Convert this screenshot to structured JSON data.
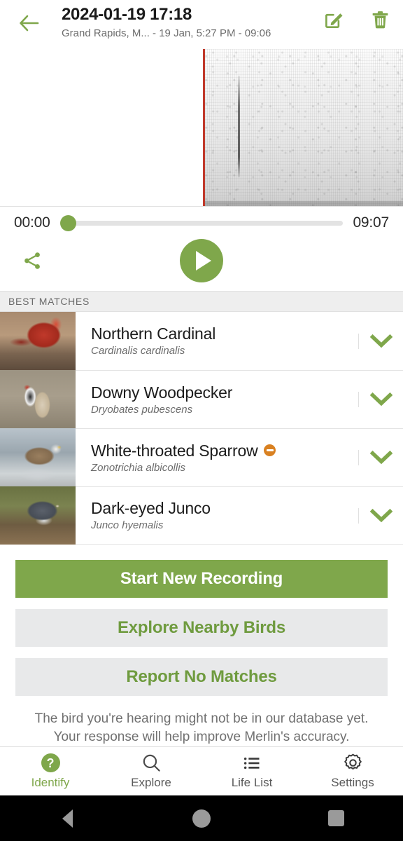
{
  "header": {
    "back_icon": "arrow-left-icon",
    "title": "2024-01-19 17:18",
    "subtitle": "Grand Rapids, M... - 19 Jan, 5:27 PM - 09:06",
    "edit_icon": "edit-pencil-icon",
    "delete_icon": "trash-icon"
  },
  "player": {
    "current_time": "00:00",
    "total_time": "09:07",
    "progress_percent": 0,
    "share_icon": "share-icon",
    "play_icon": "play-icon",
    "playhead_label": "recording-playhead"
  },
  "matches": {
    "section_label": "BEST MATCHES",
    "rows": [
      {
        "name": "Northern Cardinal",
        "scientific": "Cardinalis cardinalis",
        "thumb_class": "t-cardinal",
        "badge": false,
        "chevron_icon": "chevron-down-icon"
      },
      {
        "name": "Downy Woodpecker",
        "scientific": "Dryobates pubescens",
        "thumb_class": "t-woodpecker",
        "badge": false,
        "chevron_icon": "chevron-down-icon"
      },
      {
        "name": "White-throated Sparrow",
        "scientific": "Zonotrichia albicollis",
        "thumb_class": "t-sparrow",
        "badge": true,
        "badge_name": "rare-sighting-badge",
        "chevron_icon": "chevron-down-icon"
      },
      {
        "name": "Dark-eyed Junco",
        "scientific": "Junco hyemalis",
        "thumb_class": "t-junco",
        "badge": false,
        "chevron_icon": "chevron-down-icon"
      }
    ]
  },
  "actions": {
    "start_new_recording": "Start New Recording",
    "explore_nearby_birds": "Explore Nearby Birds",
    "report_no_matches": "Report No Matches",
    "footer_line_1": "The bird you're hearing might not be in our database yet.",
    "footer_line_2": "Your response will help improve Merlin's accuracy."
  },
  "tabbar": {
    "tabs": [
      {
        "label": "Identify",
        "icon": "question-circle-icon",
        "active": true
      },
      {
        "label": "Explore",
        "icon": "search-icon",
        "active": false
      },
      {
        "label": "Life List",
        "icon": "list-icon",
        "active": false
      },
      {
        "label": "Settings",
        "icon": "gear-icon",
        "active": false
      }
    ]
  },
  "system_nav": {
    "back_icon": "android-back-icon",
    "home_icon": "android-home-icon",
    "recents_icon": "android-recents-icon"
  },
  "colors": {
    "brand_green": "#7FA74B",
    "badge_orange": "#D98121",
    "playhead_red": "#C0392B"
  }
}
